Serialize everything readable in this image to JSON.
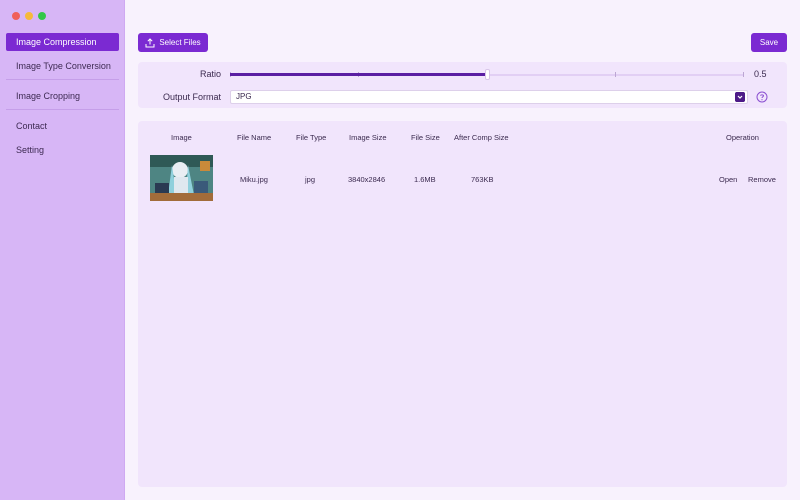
{
  "sidebar": {
    "items": [
      {
        "label": "Image Compression",
        "active": true
      },
      {
        "label": "Image Type Conversion",
        "active": false
      },
      {
        "label": "Image Cropping",
        "active": false
      },
      {
        "label": "Contact",
        "active": false
      },
      {
        "label": "Setting",
        "active": false
      }
    ]
  },
  "toolbar": {
    "select_label": "Select Files",
    "save_label": "Save",
    "select_icon": "upload-icon"
  },
  "settings": {
    "ratio_label": "Ratio",
    "ratio_value": "0.5",
    "ratio_fraction": 0.5,
    "format_label": "Output Format",
    "format_value": "JPG"
  },
  "table": {
    "headers": [
      "Image",
      "File Name",
      "File Type",
      "Image Size",
      "File Size",
      "After Comp Size",
      "Operation"
    ],
    "rows": [
      {
        "file_name": "Miku.jpg",
        "file_type": "jpg",
        "image_size": "3840x2846",
        "file_size": "1.6MB",
        "after_size": "763KB",
        "open_label": "Open",
        "remove_label": "Remove"
      }
    ]
  },
  "colors": {
    "accent": "#7b2ad2",
    "sidebar_bg": "#d7b6f6",
    "panel_bg": "#f1e5fc"
  }
}
